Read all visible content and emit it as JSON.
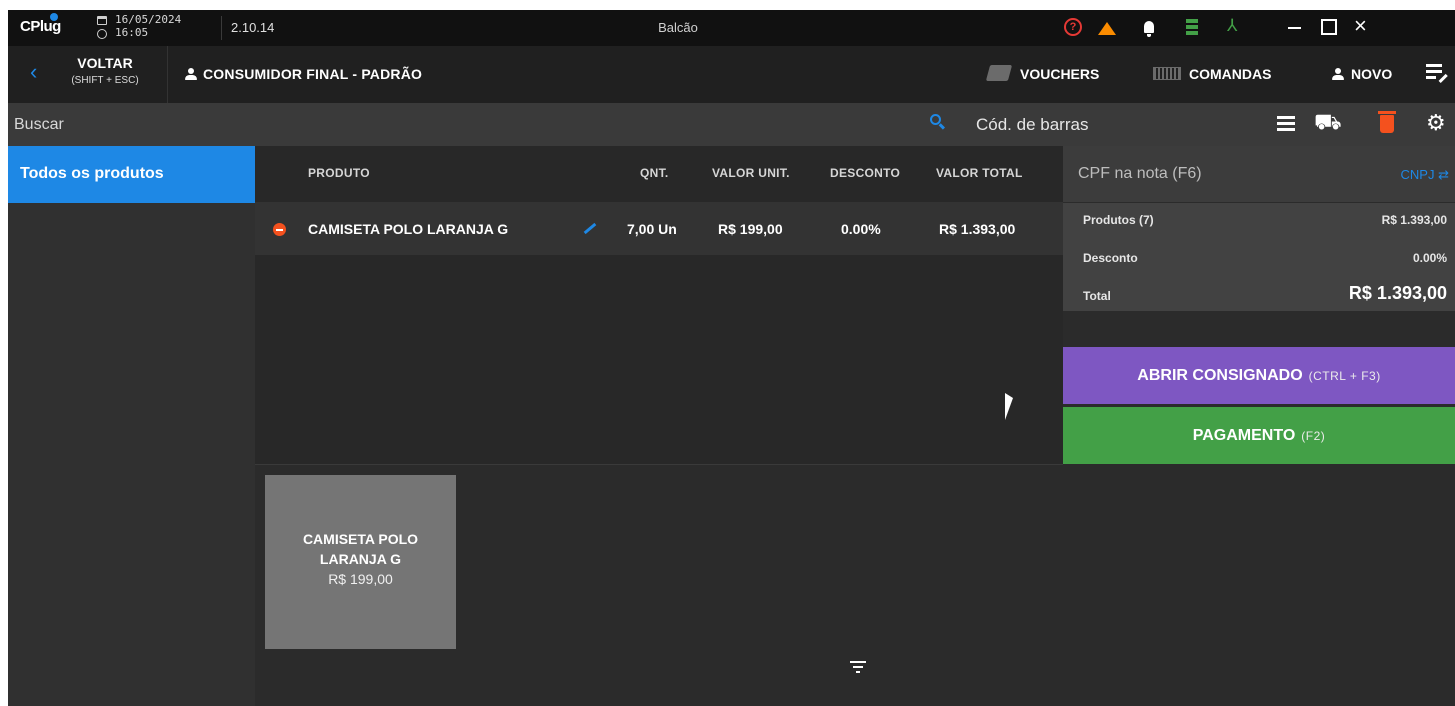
{
  "titlebar": {
    "logo": "CPlug",
    "date": "16/05/2024",
    "time": "16:05",
    "version": "2.10.14",
    "window_title": "Balcão",
    "icons": [
      "help-icon",
      "warning-icon",
      "bell-icon",
      "server-icon",
      "network-icon"
    ],
    "window_controls": [
      "minimize",
      "maximize",
      "close"
    ]
  },
  "header": {
    "back_label": "VOLTAR",
    "back_hint": "(SHIFT + ESC)",
    "customer": "CONSUMIDOR FINAL - PADRÃO",
    "vouchers_label": "VOUCHERS",
    "comandas_label": "COMANDAS",
    "novo_label": "NOVO"
  },
  "search": {
    "placeholder": "Buscar",
    "barcode_placeholder": "Cód. de barras"
  },
  "sidebar": {
    "items": [
      {
        "label": "Todos os produtos",
        "selected": true
      }
    ]
  },
  "table": {
    "columns": [
      "PRODUTO",
      "QNT.",
      "VALOR UNIT.",
      "DESCONTO",
      "VALOR TOTAL"
    ],
    "rows": [
      {
        "produto": "CAMISETA POLO LARANJA G",
        "qnt": "7,00 Un",
        "valor_unit": "R$ 199,00",
        "desconto": "0.00%",
        "valor_total": "R$ 1.393,00"
      }
    ]
  },
  "summary": {
    "cpf_label": "CPF na nota (F6)",
    "cnpj_label": "CNPJ",
    "produtos_label": "Produtos (7)",
    "produtos_value": "R$ 1.393,00",
    "desconto_label": "Desconto",
    "desconto_value": "0.00%",
    "total_label": "Total",
    "total_value": "R$ 1.393,00"
  },
  "actions": {
    "consignado_label": "ABRIR CONSIGNADO",
    "consignado_hint": "(CTRL + F3)",
    "pagamento_label": "PAGAMENTO",
    "pagamento_hint": "(F2)"
  },
  "products": [
    {
      "name": "CAMISETA POLO LARANJA G",
      "price": "R$ 199,00"
    }
  ],
  "colors": {
    "accent_blue": "#1e88e5",
    "consign_purple": "#7e57c2",
    "pay_green": "#43a047",
    "remove_red": "#f4511e"
  }
}
